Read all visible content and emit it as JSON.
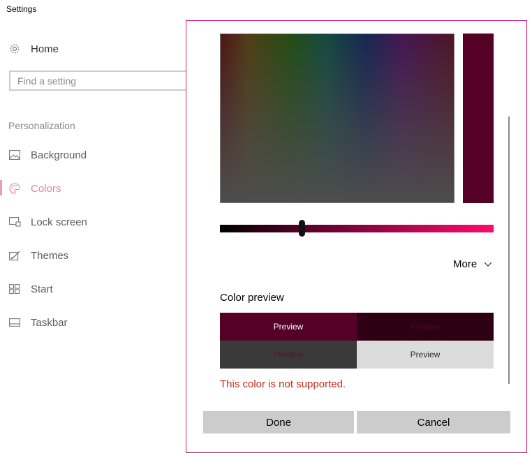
{
  "window": {
    "title": "Settings"
  },
  "sidebar": {
    "home_label": "Home",
    "search_placeholder": "Find a setting",
    "section_label": "Personalization",
    "items": [
      {
        "label": "Background",
        "icon": "picture-icon"
      },
      {
        "label": "Colors",
        "icon": "palette-icon",
        "selected": true
      },
      {
        "label": "Lock screen",
        "icon": "lock-screen-icon"
      },
      {
        "label": "Themes",
        "icon": "themes-icon"
      },
      {
        "label": "Start",
        "icon": "start-tiles-icon"
      },
      {
        "label": "Taskbar",
        "icon": "taskbar-icon"
      }
    ]
  },
  "dialog": {
    "selected_color": "#550026",
    "brightness_slider_value": 0.3,
    "more_label": "More",
    "color_preview_label": "Color preview",
    "preview_cells": [
      "Preview",
      "Preview",
      "Preview",
      "Preview"
    ],
    "error_text": "This color is not supported.",
    "done_label": "Done",
    "cancel_label": "Cancel"
  },
  "colors": {
    "accent_border": "#d4147b",
    "error": "#c42b1c",
    "selection": "#e87fa4"
  }
}
